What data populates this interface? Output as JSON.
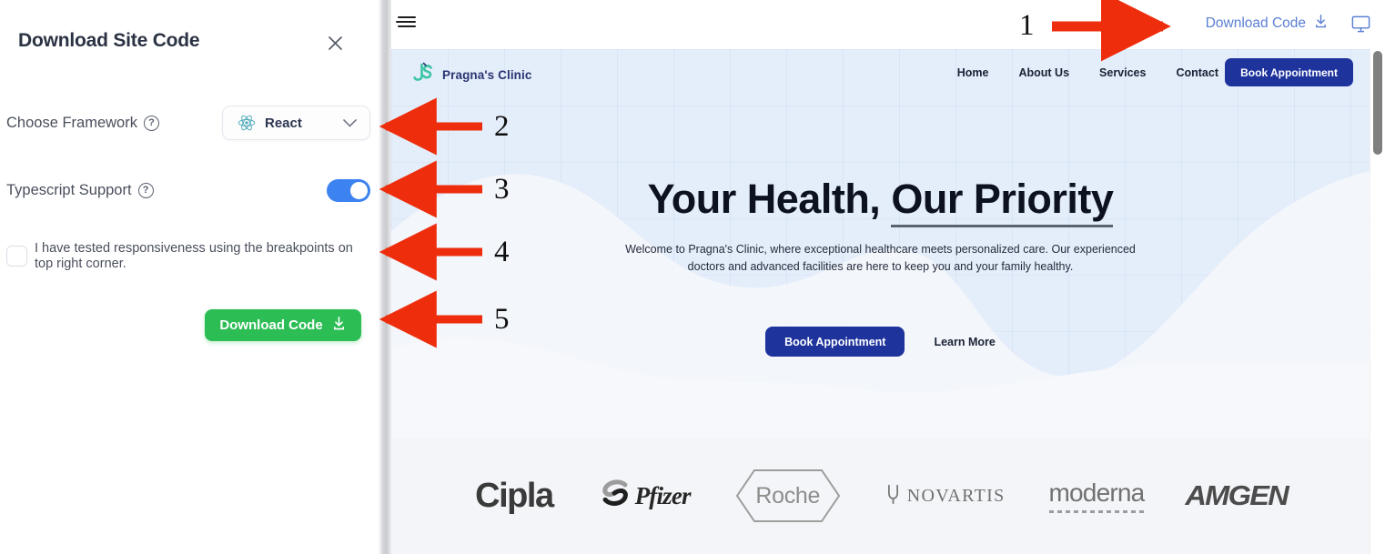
{
  "panel": {
    "title": "Download Site Code",
    "close_icon": "close-icon",
    "framework": {
      "label": "Choose Framework",
      "help_icon": "help-circle-icon",
      "selected": "React",
      "icon": "react-atom-icon",
      "chevron": "chevron-down-icon"
    },
    "typescript": {
      "label": "Typescript Support",
      "help_icon": "help-circle-icon",
      "enabled": true
    },
    "checkbox": {
      "checked": false,
      "text": "I have tested responsiveness using the breakpoints on top right corner."
    },
    "download_button": {
      "label": "Download Code",
      "icon": "download-icon",
      "color": "#2dbd55"
    }
  },
  "toolbar": {
    "menu_icon": "hamburger-menu-icon",
    "download_link": "Download Code",
    "download_link_icon": "download-icon",
    "download_link_color": "#5a7fd4",
    "device_icon": "desktop-monitor-icon"
  },
  "site": {
    "brand": {
      "name": "Pragna's Clinic",
      "logo_icon": "js-monogram-icon",
      "logo_color": "#3cc5a6"
    },
    "nav": [
      {
        "label": "Home"
      },
      {
        "label": "About Us"
      },
      {
        "label": "Services"
      },
      {
        "label": "Contact"
      }
    ],
    "nav_cta": {
      "label": "Book Appointment",
      "color": "#1e339c"
    },
    "hero": {
      "title_part1": "Your Health,",
      "title_part2": "Our Priority",
      "subtitle": "Welcome to Pragna's Clinic, where exceptional healthcare meets personalized care. Our experienced doctors and advanced facilities are here to keep you and your family healthy.",
      "primary_button": "Book Appointment",
      "secondary_button": "Learn More",
      "background_color": "#e4edfa"
    },
    "logos": [
      {
        "name": "Cipla"
      },
      {
        "name": "Pfizer"
      },
      {
        "name": "Roche"
      },
      {
        "name": "NOVARTIS"
      },
      {
        "name": "moderna"
      },
      {
        "name": "AMGEN"
      }
    ],
    "logos_background": "#f4f5f8"
  },
  "annotations": {
    "color": "#ee2d0d",
    "markers": [
      {
        "number": "1"
      },
      {
        "number": "2"
      },
      {
        "number": "3"
      },
      {
        "number": "4"
      },
      {
        "number": "5"
      }
    ]
  }
}
